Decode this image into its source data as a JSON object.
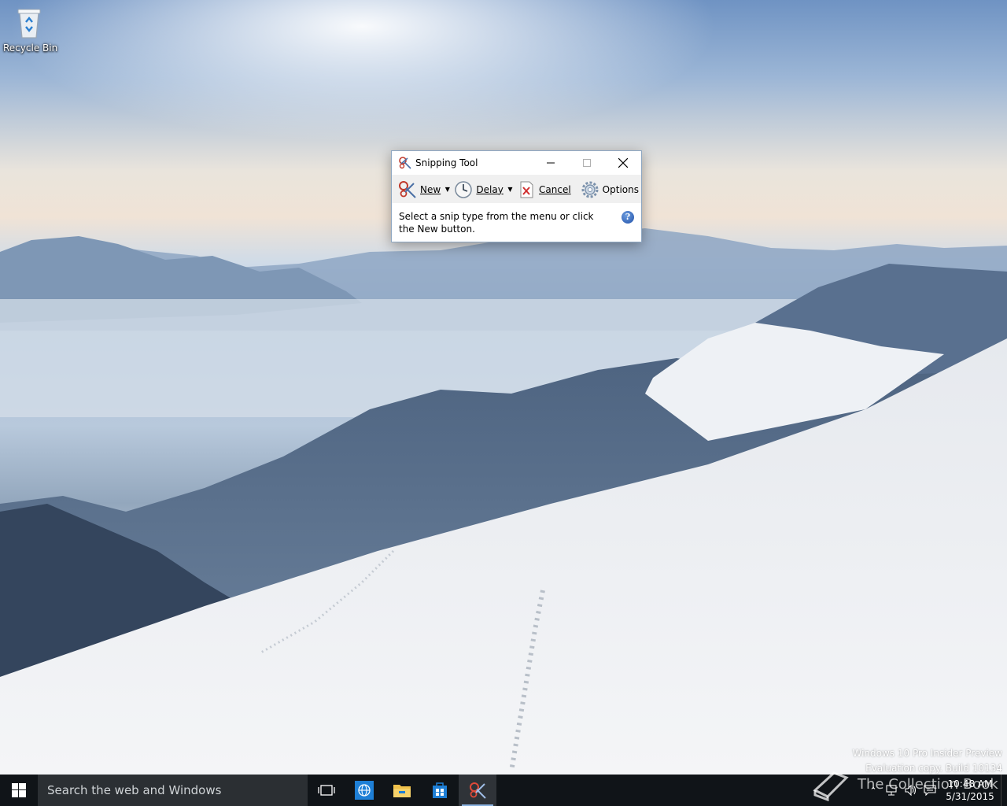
{
  "desktop": {
    "icons": [
      {
        "label": "Recycle Bin",
        "icon": "recycle-bin-icon"
      }
    ],
    "watermark": {
      "line1": "Windows 10 Pro Insider Preview",
      "line2": "Evaluation copy. Build 10134"
    }
  },
  "window": {
    "title": "Snipping Tool",
    "title_icon": "snipping-tool-icon",
    "toolbar": {
      "new_label": "New",
      "delay_label": "Delay",
      "cancel_label": "Cancel",
      "options_label": "Options"
    },
    "status_text": "Select a snip type from the menu or click the New button.",
    "help_glyph": "?"
  },
  "taskbar": {
    "search_placeholder": "Search the web and Windows",
    "apps": [
      {
        "name": "task-view",
        "icon": "task-view-icon"
      },
      {
        "name": "edge",
        "icon": "globe-icon"
      },
      {
        "name": "file-explorer",
        "icon": "folder-icon"
      },
      {
        "name": "store",
        "icon": "store-icon"
      },
      {
        "name": "snipping-tool",
        "icon": "snipping-tool-icon"
      }
    ],
    "clock": {
      "time": "10:48 AM",
      "date": "5/31/2015"
    }
  },
  "overlay_watermark": "The Collection Book",
  "colors": {
    "taskbar": "#101418",
    "search_box": "#2b2f33",
    "toolbar": "#f0f0f0",
    "accent": "#0078d7"
  }
}
